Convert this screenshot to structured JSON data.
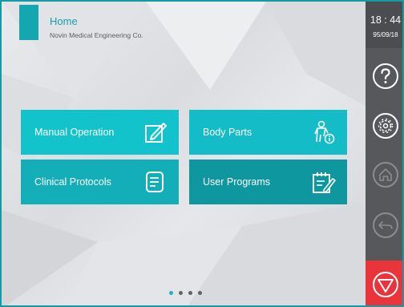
{
  "header": {
    "title": "Home",
    "subtitle": "Novin Medical Engineering Co."
  },
  "tiles": [
    {
      "label": "Manual Operation",
      "icon": "edit-document-icon"
    },
    {
      "label": "Body Parts",
      "icon": "body-info-icon"
    },
    {
      "label": "Clinical Protocols",
      "icon": "notes-list-icon"
    },
    {
      "label": "User Programs",
      "icon": "notepad-edit-icon"
    }
  ],
  "pagination": {
    "pages": 4,
    "active": 1
  },
  "status": {
    "time": "18 : 44",
    "date": "95/09/18"
  },
  "sidebar": {
    "buttons": [
      "help-icon",
      "settings-icon",
      "home-icon",
      "back-icon",
      "stop-icon"
    ]
  },
  "colors": {
    "accent": "#14a7b0",
    "tile_1": "#13c3cc",
    "tile_4": "#0f97a0",
    "sidebar": "#56585b",
    "stop": "#ea343c"
  }
}
